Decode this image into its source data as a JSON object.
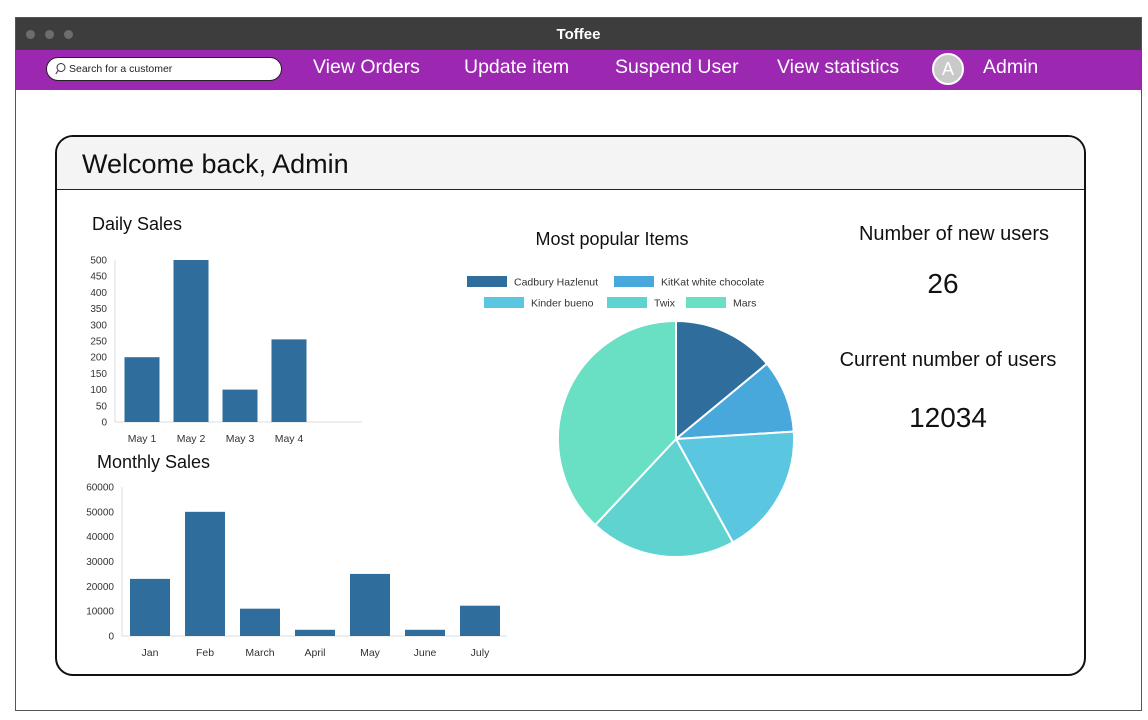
{
  "window": {
    "title": "Toffee"
  },
  "navbar": {
    "search_placeholder": "Search for a customer",
    "links": [
      "View Orders",
      "Update item",
      "Suspend User",
      "View statistics"
    ],
    "avatar_letter": "A",
    "user_name": "Admin"
  },
  "dashboard": {
    "welcome": "Welcome back, Admin",
    "new_users_label": "Number of new users",
    "new_users_value": "26",
    "current_users_label": "Current number of users",
    "current_users_value": "12034"
  },
  "colors": {
    "navbar": "#9c27b0",
    "bar": "#2e6d9c",
    "pie": [
      "#2e6d9c",
      "#48a8db",
      "#5bc6e0",
      "#5fd3d0",
      "#69dfc3"
    ]
  },
  "chart_data": [
    {
      "type": "bar",
      "title": "Daily Sales",
      "categories": [
        "May 1",
        "May 2",
        "May 3",
        "May 4"
      ],
      "values": [
        200,
        500,
        100,
        255
      ],
      "ylim": [
        0,
        500
      ],
      "yticks": [
        0,
        50,
        100,
        150,
        200,
        250,
        300,
        350,
        400,
        450,
        500
      ]
    },
    {
      "type": "bar",
      "title": "Monthly Sales",
      "categories": [
        "Jan",
        "Feb",
        "March",
        "April",
        "May",
        "June",
        "July"
      ],
      "values": [
        23000,
        50000,
        11000,
        2500,
        25000,
        2500,
        12200
      ],
      "ylim": [
        0,
        60000
      ],
      "yticks": [
        0,
        10000,
        20000,
        30000,
        40000,
        50000,
        60000
      ]
    },
    {
      "type": "pie",
      "title": "Most popular Items",
      "labels": [
        "Cadbury Hazlenut",
        "KitKat white chocolate",
        "Kinder bueno",
        "Twix",
        "Mars"
      ],
      "values": [
        14,
        10,
        18,
        20,
        38
      ],
      "legend": "top"
    }
  ]
}
